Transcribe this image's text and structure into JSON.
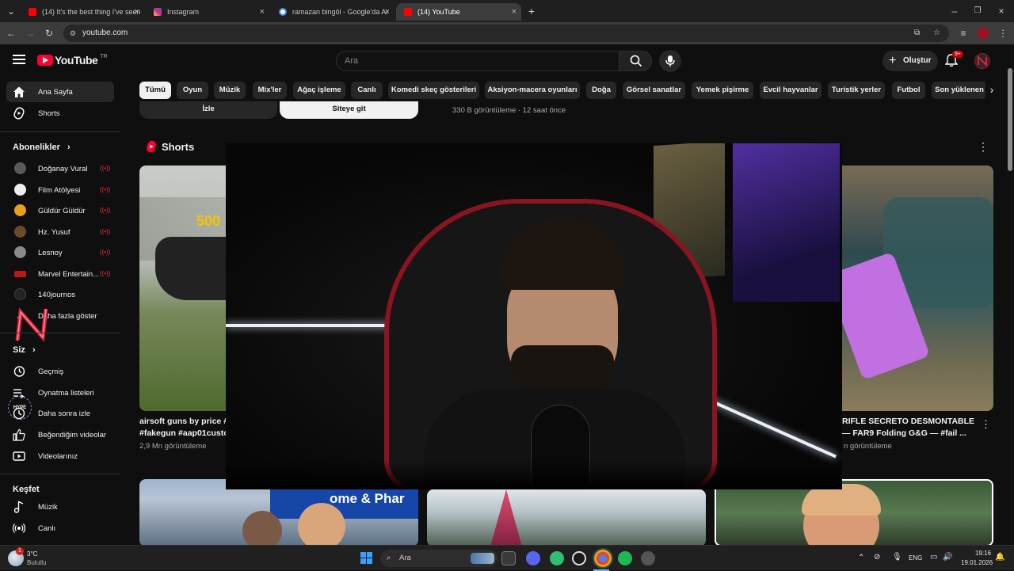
{
  "browser": {
    "tabs": [
      {
        "title": "(14) It's the best thing I've seen",
        "favicon_color": "#ff0000"
      },
      {
        "title": "Instagram",
        "favicon_color": "#d62976"
      },
      {
        "title": "ramazan bingöl - Google'da Ar",
        "favicon_color": "#4285f4"
      },
      {
        "title": "(14) YouTube",
        "favicon_color": "#ff0000"
      }
    ],
    "new_tab_label": "+",
    "url": "youtube.com"
  },
  "header": {
    "logo_text": "YouTube",
    "country_code": "TR",
    "search_placeholder": "Ara",
    "create_label": "Oluştur",
    "notification_count": "9+"
  },
  "sidebar": {
    "main": [
      {
        "label": "Ana Sayfa",
        "icon": "home-icon"
      },
      {
        "label": "Shorts",
        "icon": "shorts-icon"
      }
    ],
    "subscriptions_title": "Abonelikler",
    "subscriptions": [
      {
        "label": "Doğanay Vural",
        "avatar_color": "#555"
      },
      {
        "label": "Film Atölyesi",
        "avatar_color": "#eee"
      },
      {
        "label": "Güldür Güldür",
        "avatar_color": "#e8a01a"
      },
      {
        "label": "Hz. Yusuf",
        "avatar_color": "#6b4a2a"
      },
      {
        "label": "Lesnoy",
        "avatar_color": "#888"
      },
      {
        "label": "Marvel Entertain...",
        "avatar_color": "#c0151b"
      },
      {
        "label": "140journos",
        "avatar_color": "#222"
      }
    ],
    "show_more_label": "Daha fazla göster",
    "you_title": "Siz",
    "you_items": [
      {
        "label": "Geçmiş",
        "icon": "history-icon"
      },
      {
        "label": "Oynatma listeleri",
        "icon": "playlist-icon"
      },
      {
        "label": "Daha sonra izle",
        "icon": "watch-later-icon"
      },
      {
        "label": "Beğendiğim videolar",
        "icon": "like-icon"
      },
      {
        "label": "Videolarınız",
        "icon": "your-videos-icon"
      }
    ],
    "explore_title": "Keşfet",
    "explore_items": [
      {
        "label": "Müzik",
        "icon": "music-icon"
      },
      {
        "label": "Canlı",
        "icon": "live-icon"
      }
    ]
  },
  "chips": [
    "Tümü",
    "Oyun",
    "Müzik",
    "Mix'ler",
    "Ağaç işleme",
    "Canlı",
    "Komedi skeç gösterileri",
    "Aksiyon-macera oyunları",
    "Doğa",
    "Görsel sanatlar",
    "Yemek pişirme",
    "Evcil hayvanlar",
    "Turistik yerler",
    "Futbol",
    "Son yüklenen"
  ],
  "ad": {
    "button1": "İzle",
    "button2": "Siteye git",
    "meta": "330 B görüntüleme · 12 saat önce"
  },
  "shorts": {
    "title": "Shorts",
    "items": [
      {
        "title_line1": "airsoft guns by price #a",
        "title_line2": "#fakegun #aap01custo",
        "meta": "2,9 Mn görüntüleme"
      },
      {
        "title_line1": "RIFLE SECRETO DESMONTABLE",
        "title_line2": "— FAR9 Folding G&G — #fail ...",
        "meta": "n görüntüleme"
      }
    ]
  },
  "taskbar": {
    "weather_temp": "3°C",
    "weather_desc": "Bulutlu",
    "weather_badge": "1",
    "search_placeholder": "Ara",
    "lang": "ENG",
    "time": "19:16",
    "date": "19.01.2026"
  },
  "colors": {
    "accent_red": "#ff0033",
    "bg": "#0f0f0f"
  }
}
